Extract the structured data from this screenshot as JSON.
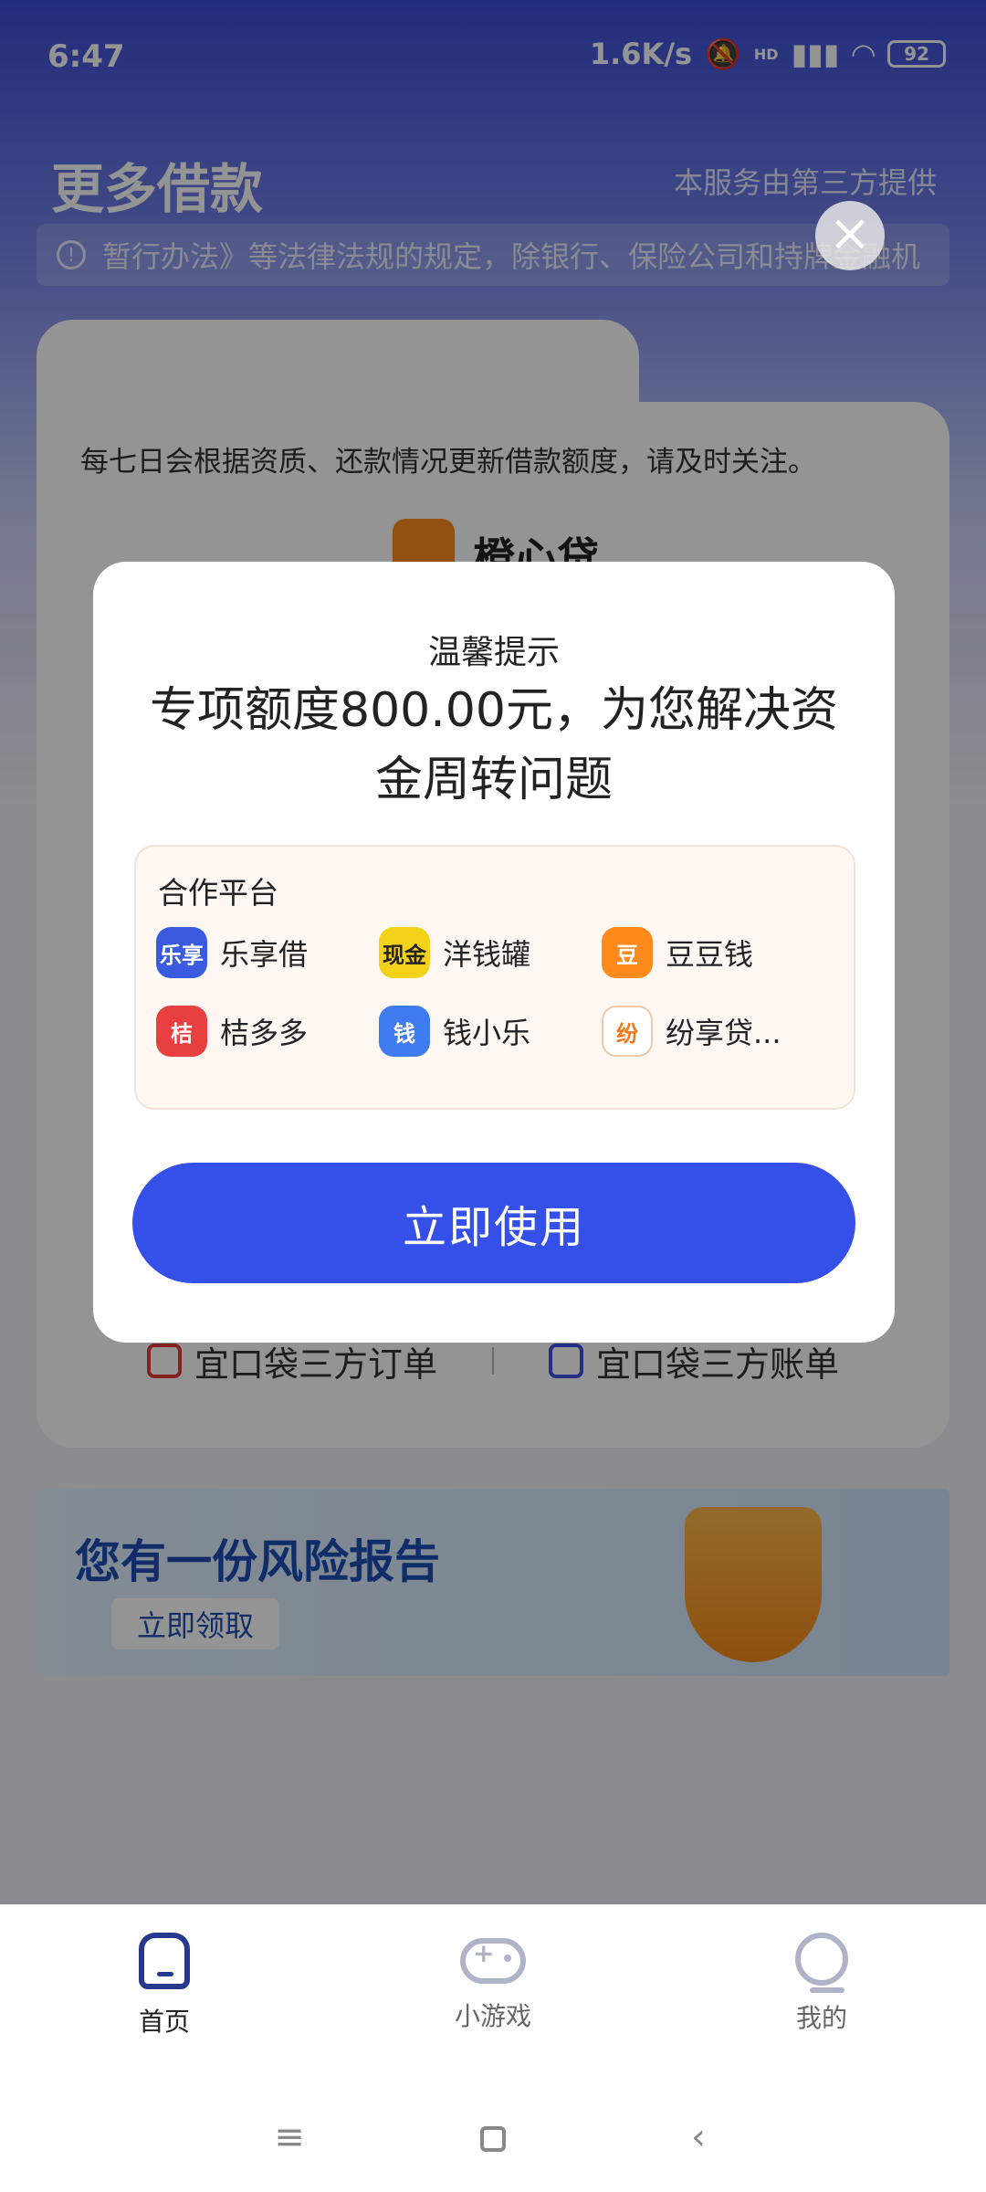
{
  "status_bar": {
    "time": "6:47",
    "network_speed": "1.6K/s",
    "signal_badge": "HD",
    "battery": "92"
  },
  "header": {
    "title": "更多借款",
    "provider_note": "本服务由第三方提供"
  },
  "notice": {
    "text": "暂行办法》等法律法规的规定，除银行、保险公司和持牌金融机"
  },
  "card": {
    "description": "每七日会根据资质、还款情况更新借款额度，请及时关注。",
    "product_name": "橙心贷"
  },
  "order_links": {
    "orders": "宜口袋三方订单",
    "bills": "宜口袋三方账单"
  },
  "banner": {
    "title": "您有一份风险报告",
    "button": "立即领取"
  },
  "modal": {
    "small_title": "温馨提示",
    "headline": "专项额度800.00元，为您解决资金周转问题",
    "partners_title": "合作平台",
    "partners": [
      {
        "name": "乐享借",
        "icon": "lexiangjie-logo",
        "color": "#3a5be0",
        "glyph": "乐享"
      },
      {
        "name": "洋钱罐",
        "icon": "yangqianguan-logo",
        "color": "#f5d21a",
        "glyph": "现金"
      },
      {
        "name": "豆豆钱",
        "icon": "doudouqian-logo",
        "color": "#ff8a1c",
        "glyph": "豆"
      },
      {
        "name": "桔多多",
        "icon": "juduoduo-logo",
        "color": "#e84040",
        "glyph": "桔"
      },
      {
        "name": "钱小乐",
        "icon": "qianxiaole-logo",
        "color": "#3f7cf0",
        "glyph": "钱"
      },
      {
        "name": "纷享贷...",
        "icon": "fenxiangdai-logo",
        "color": "#ffffff",
        "glyph": "纷"
      }
    ],
    "cta": "立即使用"
  },
  "bottom_nav": {
    "home": "首页",
    "games": "小游戏",
    "mine": "我的"
  },
  "colors": {
    "primary": "#3550e8",
    "nav_active": "#27388f"
  }
}
